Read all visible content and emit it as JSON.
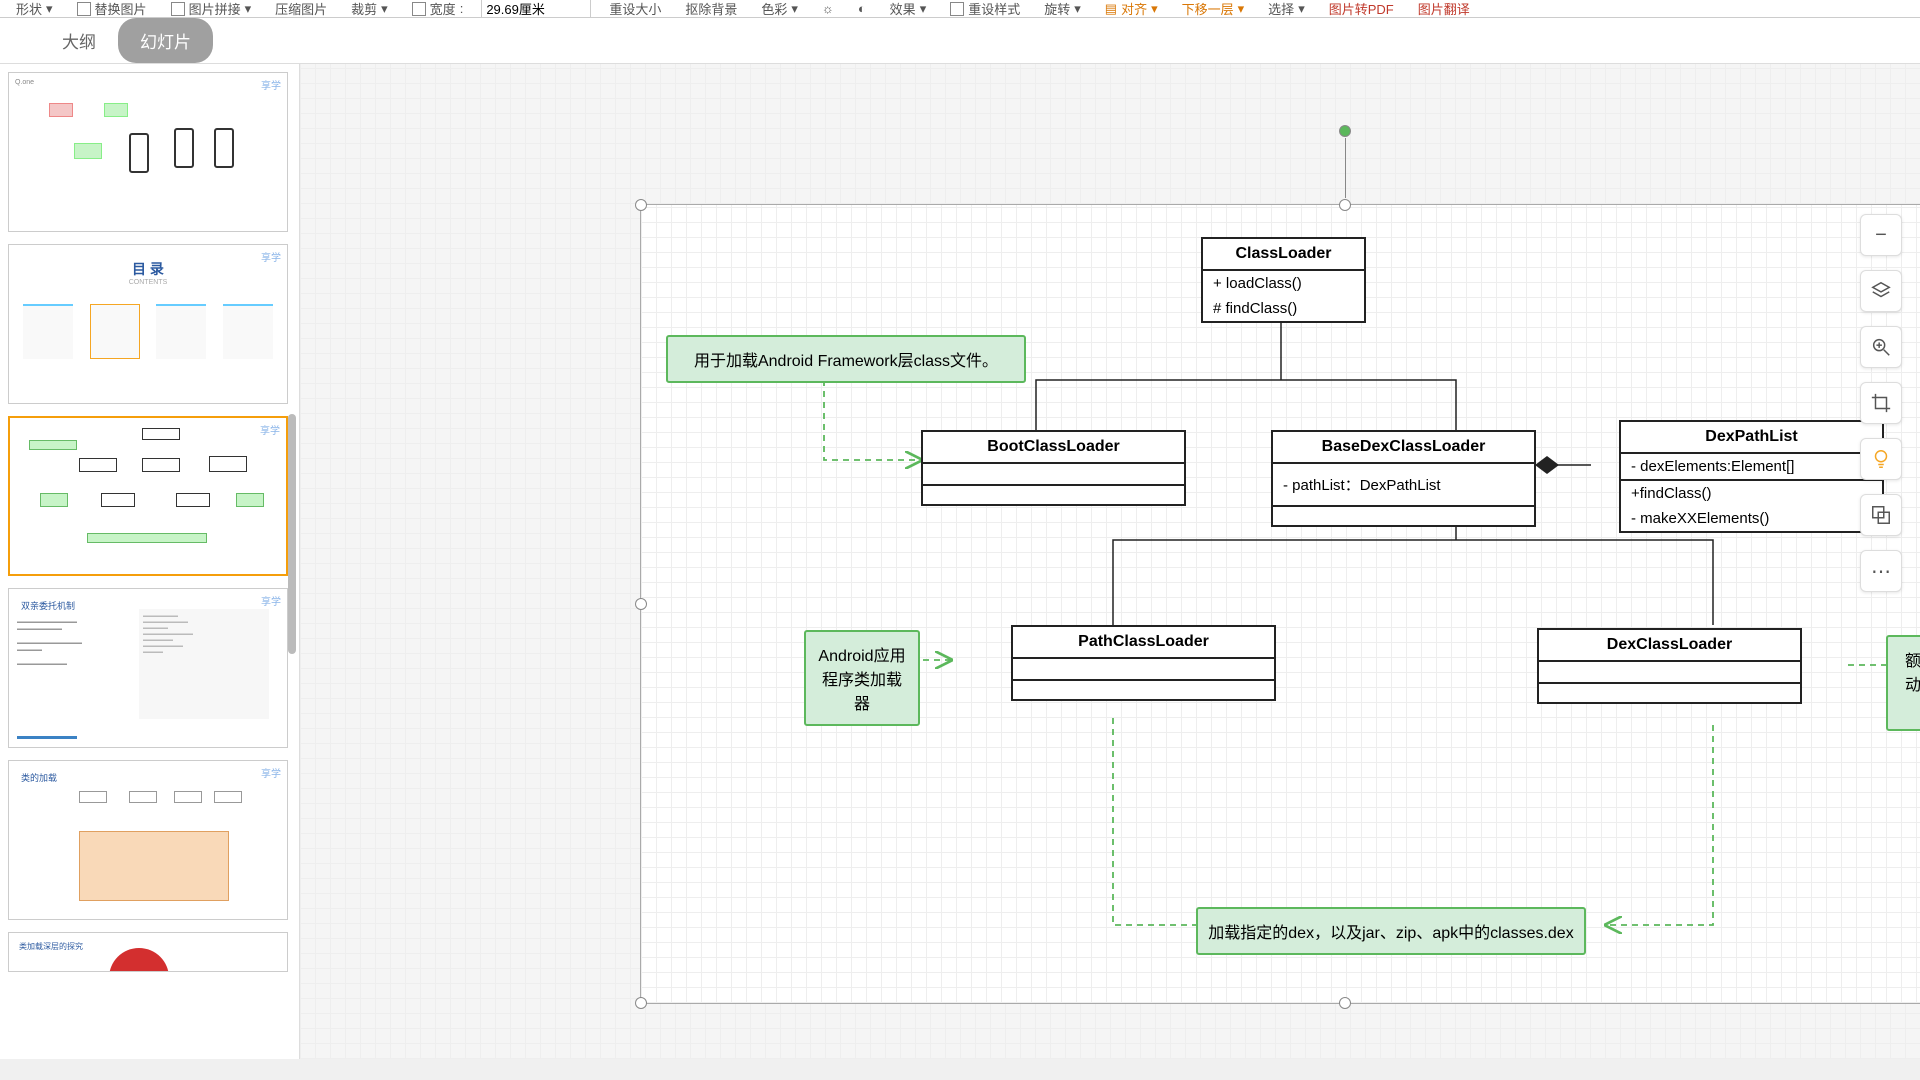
{
  "toolbar": {
    "items": [
      "形状",
      "替换图片",
      "图片拼接",
      "压缩图片",
      "裁剪",
      "宽度",
      "重设大小",
      "抠除背景",
      "色彩",
      "效果",
      "重设样式",
      "旋转",
      "对齐",
      "下移一层",
      "选择",
      "图片转PDF",
      "图片翻译"
    ],
    "width_value": "29.69厘米"
  },
  "tabs": {
    "outline": "大纲",
    "slides": "幻灯片"
  },
  "diagram": {
    "classloader": {
      "title": "ClassLoader",
      "m1": "+ loadClass()",
      "m2": "# findClass()"
    },
    "boot": {
      "title": "BootClassLoader"
    },
    "basedex": {
      "title": "BaseDexClassLoader",
      "f1": "- pathList：DexPathList"
    },
    "dexpath": {
      "title": "DexPathList",
      "f1": "- dexElements:Element[]",
      "m1": "+findClass()",
      "m2": "- makeXXElements()"
    },
    "pathcl": {
      "title": "PathClassLoader"
    },
    "dexcl": {
      "title": "DexClassLoader"
    },
    "note_framework": "用于加载Android Framework层class文件。",
    "note_app": "Android应用程序类加载器",
    "note_extra": "额外提供的动态类加载器",
    "note_bottom": "加载指定的dex，以及jar、zip、apk中的classes.dex"
  },
  "thumbs": {
    "t2_title": "目 录",
    "t2_sub": "CONTENTS",
    "t4_title": "双亲委托机制",
    "t5_title": "类的加载"
  },
  "right_tools": [
    "−",
    "layers",
    "zoom",
    "crop",
    "bulb",
    "replace",
    "more"
  ]
}
